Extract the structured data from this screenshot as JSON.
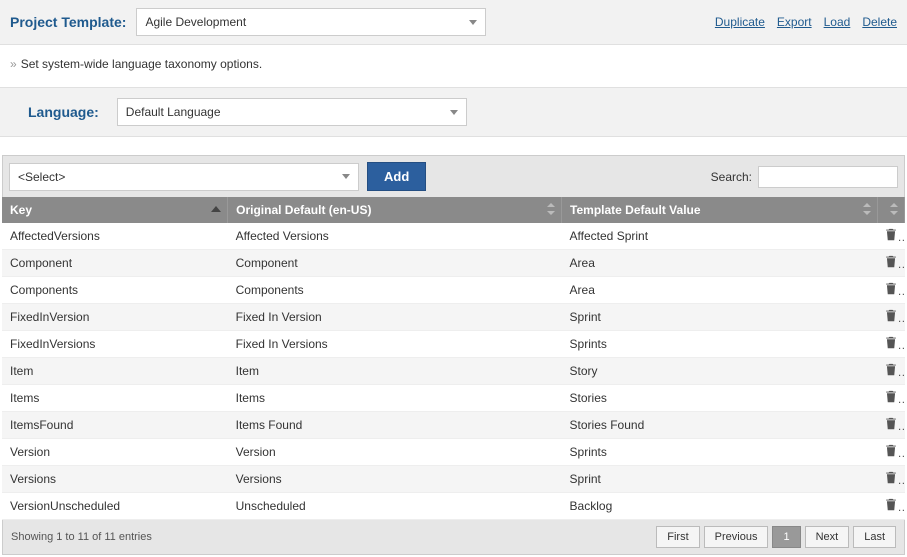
{
  "header": {
    "template_label": "Project Template:",
    "template_value": "Agile Development",
    "actions": {
      "duplicate": "Duplicate",
      "export": "Export",
      "load": "Load",
      "delete": "Delete"
    }
  },
  "subtitle": "Set system-wide language taxonomy options.",
  "language": {
    "label": "Language:",
    "value": "Default Language"
  },
  "toolbar": {
    "select_placeholder": "<Select>",
    "add_label": "Add",
    "search_label": "Search:"
  },
  "table": {
    "columns": {
      "key": "Key",
      "original": "Original Default (en-US)",
      "value": "Template Default Value"
    },
    "rows": [
      {
        "key": "AffectedVersions",
        "original": "Affected Versions",
        "value": "Affected Sprint"
      },
      {
        "key": "Component",
        "original": "Component",
        "value": "Area"
      },
      {
        "key": "Components",
        "original": "Components",
        "value": "Area"
      },
      {
        "key": "FixedInVersion",
        "original": "Fixed In Version",
        "value": "Sprint"
      },
      {
        "key": "FixedInVersions",
        "original": "Fixed In Versions",
        "value": "Sprints"
      },
      {
        "key": "Item",
        "original": "Item",
        "value": "Story"
      },
      {
        "key": "Items",
        "original": "Items",
        "value": "Stories"
      },
      {
        "key": "ItemsFound",
        "original": "Items Found",
        "value": "Stories Found"
      },
      {
        "key": "Version",
        "original": "Version",
        "value": "Sprints"
      },
      {
        "key": "Versions",
        "original": "Versions",
        "value": "Sprint"
      },
      {
        "key": "VersionUnscheduled",
        "original": "Unscheduled",
        "value": "Backlog"
      }
    ]
  },
  "footer": {
    "info": "Showing 1 to 11 of 11 entries",
    "pager": {
      "first": "First",
      "previous": "Previous",
      "page": "1",
      "next": "Next",
      "last": "Last"
    }
  }
}
